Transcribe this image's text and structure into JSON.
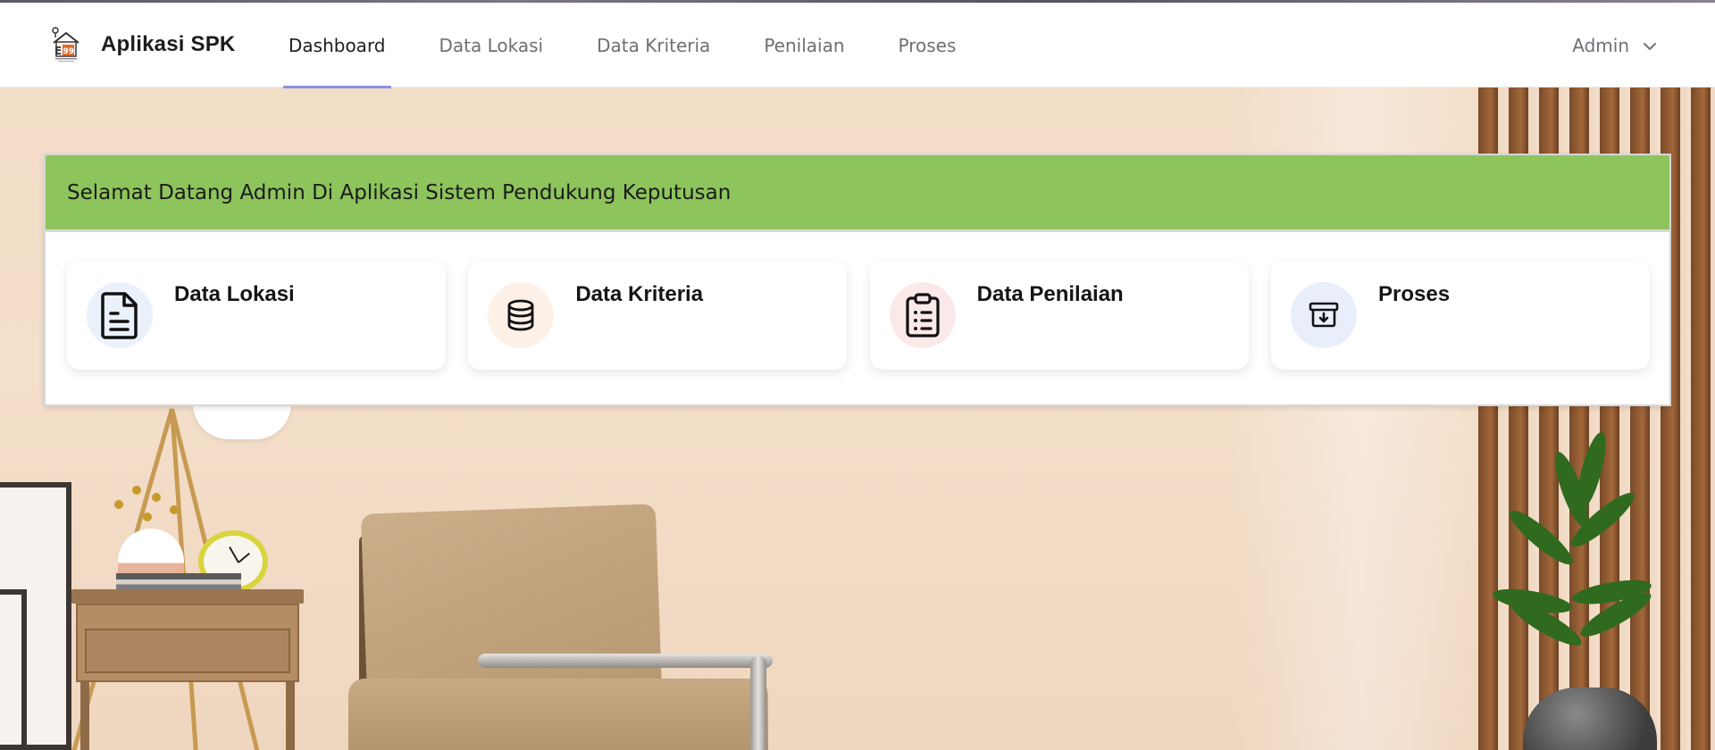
{
  "app": {
    "title": "Aplikasi SPK",
    "logo_icon": "house-logo-icon"
  },
  "nav": {
    "items": [
      {
        "label": "Dashboard",
        "active": true
      },
      {
        "label": "Data Lokasi",
        "active": false
      },
      {
        "label": "Data Kriteria",
        "active": false
      },
      {
        "label": "Penilaian",
        "active": false
      },
      {
        "label": "Proses",
        "active": false
      }
    ],
    "active_underline_color": "#8e8ee0"
  },
  "user": {
    "name": "Admin",
    "dropdown_icon": "chevron-down-icon"
  },
  "welcome": {
    "message": "Selamat Datang Admin Di Aplikasi Sistem Pendukung Keputusan",
    "header_color": "#8dc45b"
  },
  "cards": [
    {
      "title": "Data Lokasi",
      "icon": "document-icon",
      "icon_bg": "#eaf1fb"
    },
    {
      "title": "Data Kriteria",
      "icon": "database-icon",
      "icon_bg": "#fdf1e7"
    },
    {
      "title": "Data Penilaian",
      "icon": "clipboard-list-icon",
      "icon_bg": "#fbe9ea"
    },
    {
      "title": "Proses",
      "icon": "archive-download-icon",
      "icon_bg": "#e9eefb"
    }
  ]
}
